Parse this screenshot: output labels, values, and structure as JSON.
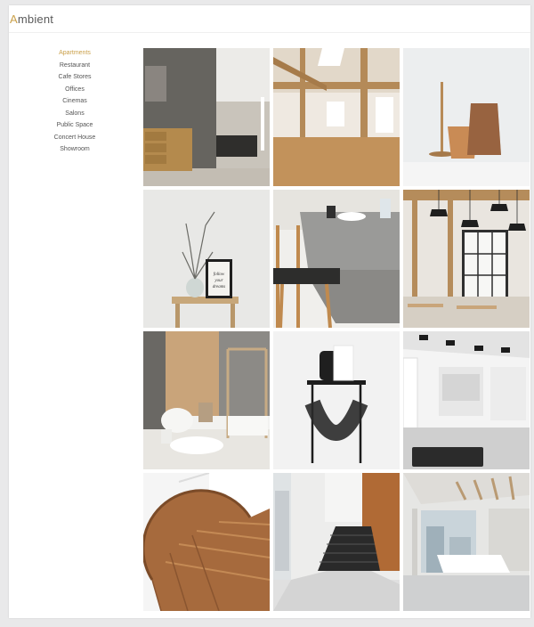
{
  "brand": {
    "first": "A",
    "rest": "mbient",
    "accent": "#caa04a"
  },
  "nav": [
    {
      "label": "Apartments",
      "active": true
    },
    {
      "label": "Restaurant"
    },
    {
      "label": "Cafe Stores"
    },
    {
      "label": "Offices"
    },
    {
      "label": "Cinemas"
    },
    {
      "label": "Salons"
    },
    {
      "label": "Public Space"
    },
    {
      "label": "Concert House"
    },
    {
      "label": "Showroom"
    }
  ],
  "gallery": {
    "tiles": [
      {
        "name": "concrete-wall-living-room-photo"
      },
      {
        "name": "wooden-beam-loft-photo"
      },
      {
        "name": "copper-vases-photo"
      },
      {
        "name": "branch-vase-frame-photo"
      },
      {
        "name": "dining-table-chair-photo"
      },
      {
        "name": "pendant-lamp-cafe-photo"
      },
      {
        "name": "bedroom-wood-wall-photo"
      },
      {
        "name": "black-side-table-photo"
      },
      {
        "name": "white-showroom-photo"
      },
      {
        "name": "spiral-staircase-photo"
      },
      {
        "name": "stair-hall-photo"
      },
      {
        "name": "skylight-lobby-photo"
      }
    ],
    "frame_text": [
      "follow",
      "your",
      "dreams"
    ]
  }
}
